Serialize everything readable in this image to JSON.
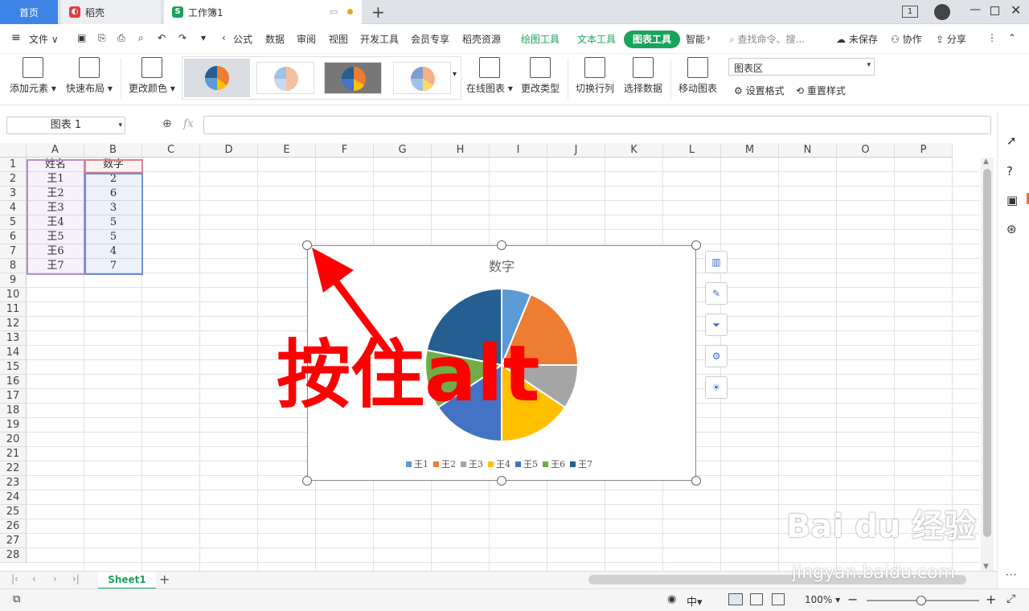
{
  "tabs": {
    "home": "首页",
    "daoke": "稻壳",
    "workbook": "工作簿1",
    "add": "+"
  },
  "menu": {
    "file": "文件",
    "items": [
      "公式",
      "数据",
      "审阅",
      "视图",
      "开发工具",
      "会员专享",
      "稻壳资源"
    ],
    "draw_tools": "绘图工具",
    "text_tools": "文本工具",
    "chart_tools": "图表工具",
    "smart": "智能",
    "search_placeholder": "查找命令、搜...",
    "unsaved": "未保存",
    "collab": "协作",
    "share": "分享"
  },
  "ribbon": {
    "add_element": "添加元素",
    "quick_layout": "快速布局",
    "change_color": "更改颜色",
    "online_chart": "在线图表",
    "change_type": "更改类型",
    "switch_rowcol": "切换行列",
    "select_data": "选择数据",
    "move_chart": "移动图表",
    "chart_area_select": "图表区",
    "set_format": "设置格式",
    "reset_style": "重置样式"
  },
  "formula_bar": {
    "name_box": "图表 1",
    "fx": "fx",
    "value": ""
  },
  "columns": [
    "A",
    "B",
    "C",
    "D",
    "E",
    "F",
    "G",
    "H",
    "I",
    "J",
    "K",
    "L",
    "M",
    "N",
    "O",
    "P"
  ],
  "rows": [
    "1",
    "2",
    "3",
    "4",
    "5",
    "6",
    "7",
    "8",
    "9",
    "10",
    "11",
    "12",
    "13",
    "14",
    "15",
    "16",
    "17",
    "18",
    "19",
    "20",
    "21",
    "22",
    "23",
    "24",
    "25",
    "26",
    "27",
    "28"
  ],
  "table": {
    "headers": [
      "姓名",
      "数字"
    ],
    "rows": [
      [
        "王1",
        "2"
      ],
      [
        "王2",
        "6"
      ],
      [
        "王3",
        "3"
      ],
      [
        "王4",
        "5"
      ],
      [
        "王5",
        "5"
      ],
      [
        "王6",
        "4"
      ],
      [
        "王7",
        "7"
      ]
    ]
  },
  "chart_data": {
    "type": "pie",
    "title": "数字",
    "categories": [
      "王1",
      "王2",
      "王3",
      "王4",
      "王5",
      "王6",
      "王7"
    ],
    "values": [
      2,
      6,
      3,
      5,
      5,
      4,
      7
    ],
    "colors": [
      "#5b9bd5",
      "#ed7d31",
      "#a5a5a5",
      "#ffc000",
      "#4472c4",
      "#70ad47",
      "#255e91"
    ],
    "legend_position": "bottom"
  },
  "overlay": {
    "text_cn": "按住",
    "text_key": "alt",
    "color": "#ff0000"
  },
  "sheets": [
    "Sheet1"
  ],
  "status": {
    "zoom": "100%"
  },
  "watermark": {
    "main": "Bai du 经验",
    "sub": "jingyan.baidu.com"
  }
}
